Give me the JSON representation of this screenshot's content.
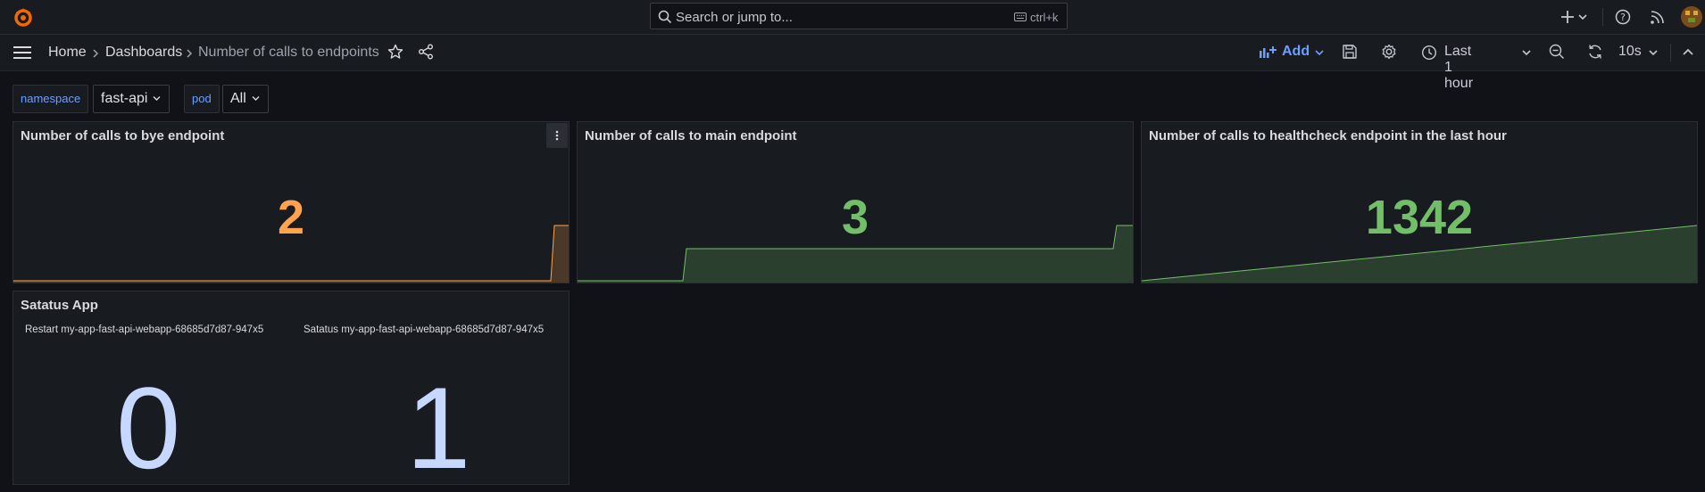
{
  "topbar": {
    "search": {
      "placeholder": "Search or jump to...",
      "shortcut": "ctrl+k"
    },
    "icons": [
      "grafana-logo",
      "plus-icon",
      "help-icon",
      "news-icon",
      "user-avatar"
    ]
  },
  "breadcrumb": {
    "items": [
      "Home",
      "Dashboards",
      "Number of calls to endpoints"
    ]
  },
  "toolbar": {
    "add_label": "Add",
    "time_range": "Last 1 hour",
    "refresh_interval": "10s"
  },
  "variables": {
    "namespace": {
      "label": "namespace",
      "value": "fast-api"
    },
    "pod": {
      "label": "pod",
      "value": "All"
    }
  },
  "panels": {
    "bye": {
      "title": "Number of calls to bye endpoint",
      "value": "2",
      "color": "#ffa34e"
    },
    "main": {
      "title": "Number of calls to main endpoint",
      "value": "3",
      "color": "#73bf69"
    },
    "healthcheck": {
      "title": "Number of calls to healthcheck endpoint in the last hour",
      "value": "1342",
      "color": "#73bf69"
    },
    "status": {
      "title": "Satatus App",
      "restart_label": "Restart my-app-fast-api-webapp-68685d7d87-947x5",
      "restart_value": "0",
      "status_label": "Satatus my-app-fast-api-webapp-68685d7d87-947x5",
      "status_value": "1",
      "value_color": "#c6d8ff"
    }
  },
  "colors": {
    "background": "#111217",
    "panel": "#181b1f",
    "accent_blue": "#6e9fff",
    "orange": "#ffa34e",
    "green": "#73bf69"
  }
}
